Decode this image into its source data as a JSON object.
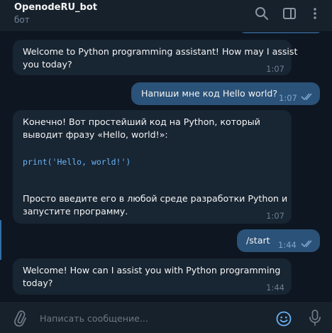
{
  "header": {
    "title": "OpenodeRU_bot",
    "subtitle": "бот"
  },
  "messages": [
    {
      "direction": "in",
      "lines": [
        "Welcome to Python programming assistant! How may I assist",
        "you today?"
      ],
      "time": "1:07"
    },
    {
      "direction": "out",
      "text": "Напиши мне код Hello world?",
      "time": "1:07"
    },
    {
      "direction": "in",
      "lines": [
        "Конечно! Вот простейший код на Python, который",
        "выводит фразу «Hello, world!»:"
      ],
      "code": "print('Hello, world!')",
      "lines_after": [
        "Просто введите его в любой среде разработки Python и",
        "запустите программу."
      ],
      "time": "1:07"
    },
    {
      "direction": "out",
      "text": "/start",
      "time": "1:44"
    },
    {
      "direction": "in",
      "lines": [
        "Welcome! How can I assist you with Python programming",
        "today?"
      ],
      "time": "1:44"
    }
  ],
  "composer": {
    "placeholder": "Написать сообщение..."
  },
  "icons": {
    "search": "search-icon",
    "sidebar": "sidebar-toggle-icon",
    "menu": "more-vertical-icon",
    "attach": "paperclip-icon",
    "emoji": "emoji-icon",
    "mic": "microphone-icon"
  },
  "colors": {
    "background": "#0e1621",
    "panel": "#17212b",
    "incoming_bubble": "#182533",
    "outgoing_bubble": "#2b5278",
    "accent": "#6ab3f3"
  }
}
